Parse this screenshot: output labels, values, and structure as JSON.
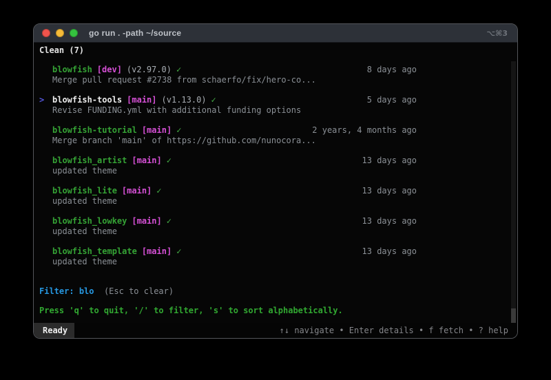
{
  "window": {
    "title": "go run . -path ~/source",
    "shortcut": "⌥⌘3"
  },
  "header": {
    "label": "Clean (7)"
  },
  "repo_list": {
    "rows": [
      {
        "selected": false,
        "cursor": "",
        "name": "blowfish",
        "branch": "[dev]",
        "version": "(v2.97.0)",
        "check": "✓",
        "time": "8 days ago",
        "message": "Merge pull request #2738 from schaerfo/fix/hero-co..."
      },
      {
        "selected": true,
        "cursor": ">",
        "name": "blowfish-tools",
        "branch": "[main]",
        "version": "(v1.13.0)",
        "check": "✓",
        "time": "5 days ago",
        "message": "Revise FUNDING.yml with additional funding options"
      },
      {
        "selected": false,
        "cursor": "",
        "name": "blowfish-tutorial",
        "branch": "[main]",
        "version": "",
        "check": "✓",
        "time": "2 years, 4 months ago",
        "message": "Merge branch 'main' of https://github.com/nunocora..."
      },
      {
        "selected": false,
        "cursor": "",
        "name": "blowfish_artist",
        "branch": "[main]",
        "version": "",
        "check": "✓",
        "time": "13 days ago",
        "message": "updated theme"
      },
      {
        "selected": false,
        "cursor": "",
        "name": "blowfish_lite",
        "branch": "[main]",
        "version": "",
        "check": "✓",
        "time": "13 days ago",
        "message": "updated theme"
      },
      {
        "selected": false,
        "cursor": "",
        "name": "blowfish_lowkey",
        "branch": "[main]",
        "version": "",
        "check": "✓",
        "time": "13 days ago",
        "message": "updated theme"
      },
      {
        "selected": false,
        "cursor": "",
        "name": "blowfish_template",
        "branch": "[main]",
        "version": "",
        "check": "✓",
        "time": "13 days ago",
        "message": "updated theme"
      }
    ]
  },
  "filter": {
    "label": "Filter:",
    "value": "blo",
    "hint": "(Esc to clear)"
  },
  "help": {
    "text": "Press 'q' to quit, '/' to filter, 's' to sort alphabetically."
  },
  "status_bar": {
    "state": "Ready",
    "hints": "↑↓ navigate • Enter details • f fetch • ? help"
  },
  "colors": {
    "repo_name_green": "#35a335",
    "branch_magenta": "#d650d6",
    "check_green": "#46b046",
    "selected_name": "#ededed",
    "cursor_indigo": "#5457dd",
    "filter_blue": "#2697e0",
    "help_green": "#31a831",
    "muted_text": "#8b9096",
    "version_text": "#a9aeb4",
    "titlebar_bg": "#2d3138",
    "traffic_red": "#f0544c",
    "traffic_yellow": "#f5bb38",
    "traffic_green": "#35c23f"
  }
}
